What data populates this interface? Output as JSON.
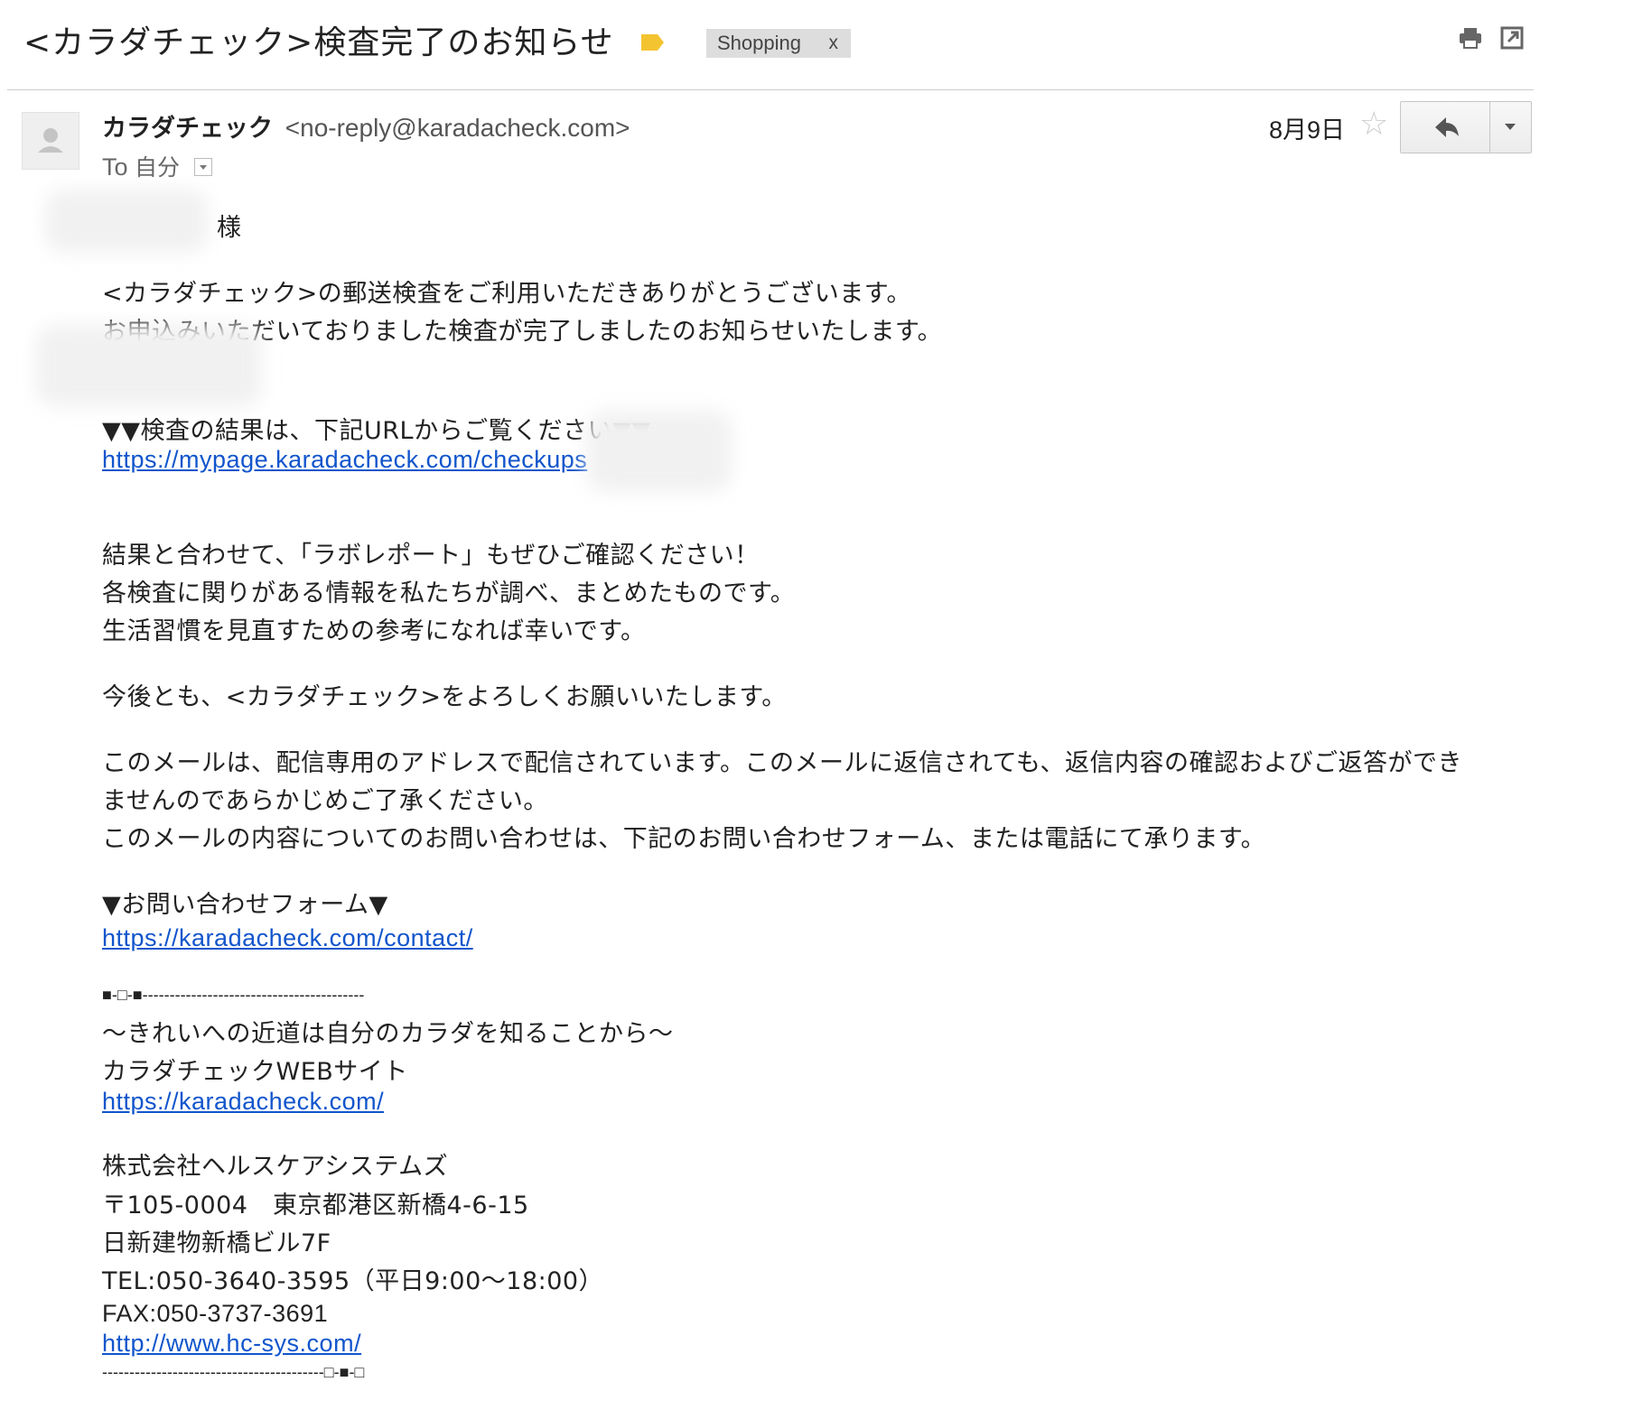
{
  "header": {
    "subject": "<カラダチェック>検査完了のお知らせ",
    "label_chip": "Shopping",
    "label_chip_remove": "x",
    "label_color": "#f4c430"
  },
  "message": {
    "sender_name": "カラダチェック",
    "sender_email": "<no-reply@karadacheck.com>",
    "to_prefix": "To",
    "to_me": "自分",
    "date": "8月9日"
  },
  "body": {
    "salutation_suffix": "様",
    "intro_line1": "<カラダチェック>の郵送検査をご利用いただきありがとうございます。",
    "intro_line2": "お申込みいただいておりました検査が完了しましたのお知らせいたします。",
    "result_heading": "▼▼検査の結果は、下記URLからご覧ください▼▼",
    "result_link": "https://mypage.karadacheck.com/checkups",
    "lab_line1": "結果と合わせて、「ラボレポート」もぜひご確認ください！",
    "lab_line2": "各検査に関りがある情報を私たちが調べ、まとめたものです。",
    "lab_line3": "生活習慣を見直すための参考になれば幸いです。",
    "closing": "今後とも、<カラダチェック>をよろしくお願いいたします。",
    "notice_line1": "このメールは、配信専用のアドレスで配信されています。このメールに返信されても、返信内容の確認およびご返答ができ",
    "notice_line2": "ませんのであらかじめご了承ください。",
    "notice_line3": "このメールの内容についてのお問い合わせは、下記のお問い合わせフォーム、または電話にて承ります。",
    "contact_heading": "▼お問い合わせフォーム▼",
    "contact_link": "https://karadacheck.com/contact/"
  },
  "signature": {
    "rule_top": "■-□-■-----------------------------------------",
    "tagline": "〜きれいへの近道は自分のカラダを知ることから〜",
    "site_name": "カラダチェックWEBサイト",
    "site_link": "https://karadacheck.com/",
    "company": "株式会社ヘルスケアシステムズ",
    "address1": "〒105-0004　東京都港区新橋4-6-15",
    "address2": "日新建物新橋ビル7F",
    "tel": "TEL:050-3640-3595（平日9:00〜18:00）",
    "fax": "FAX:050-3737-3691",
    "company_link": "http://www.hc-sys.com/",
    "rule_bottom": "-----------------------------------------□-■-□"
  },
  "icons": {
    "print": "print-icon",
    "popout": "open-in-new-window-icon",
    "star": "star-icon",
    "reply": "reply-icon",
    "more": "chevron-down-icon",
    "avatar": "person-icon",
    "label": "label-icon"
  }
}
